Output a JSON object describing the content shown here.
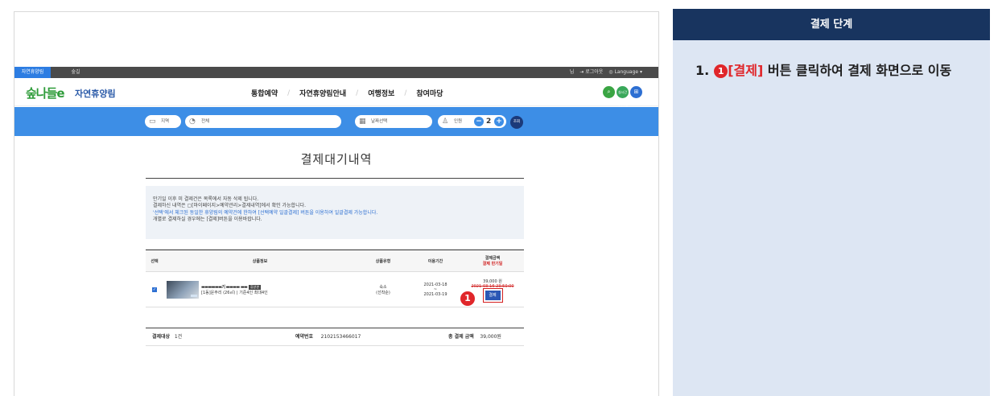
{
  "screenshot": {
    "topbar": {
      "tab_active": "자연휴양림",
      "tab_second": "숲길",
      "user": "님",
      "logout": "⇥ 로그아웃",
      "language": "◎ Language ▾"
    },
    "header": {
      "logo": "숲나들e",
      "site_title": "자연휴양림",
      "nav": [
        "통합예약",
        "자연휴양림안내",
        "여행정보",
        "참여마당"
      ],
      "nav_separator": "/",
      "icon_search": "⌕",
      "icon_mid": "실시간 예약가능",
      "icon_grid": "⊞"
    },
    "searchbar": {
      "region": "지역",
      "all": "전체",
      "date": "날짜선택",
      "people_label": "인원",
      "people_count": "2",
      "minus": "−",
      "plus": "+",
      "go": "조회"
    },
    "page_title": "결제대기내역",
    "notice": {
      "line1": "만기일 이후 미 결제건은 목록에서 자동 삭제 됩니다.",
      "line2": "결제하신 내역은 ▢[마이페이지>예약관리>결제내역]에서 확인 가능합니다.",
      "line3": "'선택'에서 체크된 동일한 휴양림의 예약건에 한하여 [선택예약 일괄결제] 버튼을 이용하여 일괄결제 가능합니다.",
      "line4": "개별로 결제하실 경우에는 [결제]버튼을 이용바랍니다."
    },
    "table": {
      "headers": {
        "select": "선택",
        "product": "상품정보",
        "type": "상품유형",
        "period": "이용기간",
        "amount": "결제금액",
        "due": "결제 만기일"
      },
      "row": {
        "checked": "✓",
        "name": "▬▬▬▬▬▬기 ▬▬▬▬ ▬▬",
        "badge": "휴양관",
        "detail": "[1동]운주리 (26㎡) | 기준4인 최대4인",
        "type": "숙소",
        "type_sub": "(선착순)",
        "period_start": "2021-03-18",
        "period_sep": "~",
        "period_end": "2021-03-19",
        "amount": "39,000 원",
        "due": "2021-03-16 23:50:00",
        "pay_button": "결제"
      }
    },
    "marker": "1",
    "summary": {
      "target_label": "결제대상",
      "target_value": "1건",
      "reservation_label": "예약번호",
      "reservation_value": "2102153466017",
      "total_label": "총 결제 금액",
      "total_value": "39,000원"
    }
  },
  "panel": {
    "title": "결제 단계",
    "step_number": "1.",
    "step_badge": "1",
    "step_highlight": "[결제]",
    "step_text": " 버튼 클릭하여 결제 화면으로 이동"
  },
  "colors": {
    "panel_header": "#18345f",
    "panel_bg": "#dde6f3",
    "highlight_red": "#e0262a",
    "search_blue": "#3d8ee6"
  }
}
